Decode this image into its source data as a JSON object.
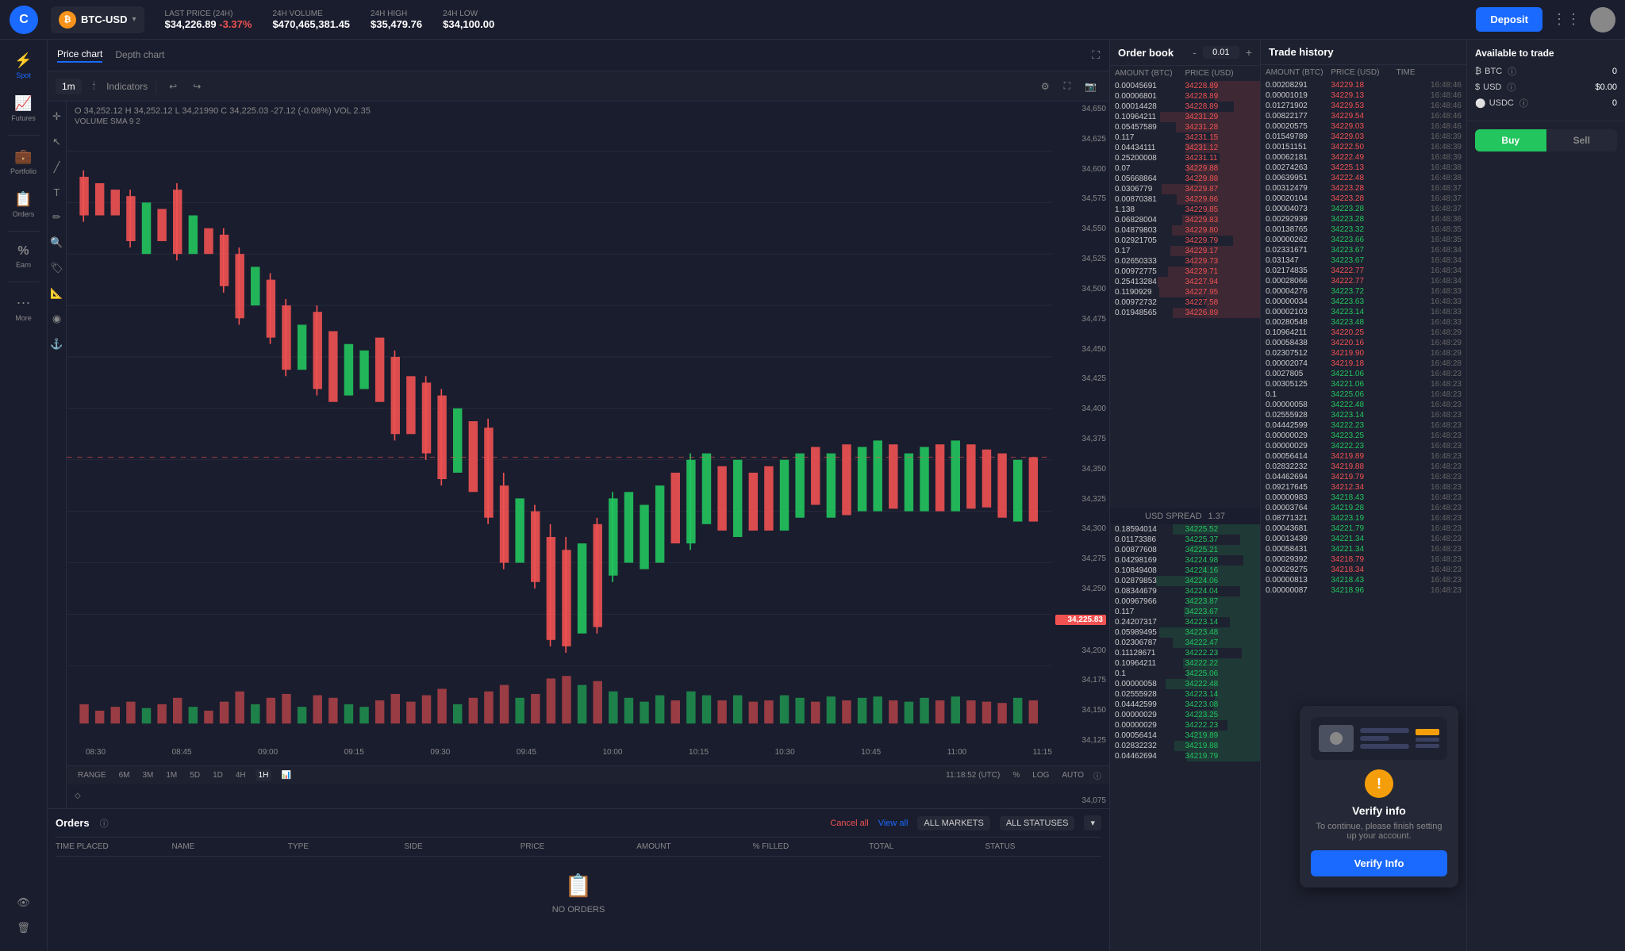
{
  "header": {
    "logo_text": "C",
    "pair": "BTC-USD",
    "btc_icon": "₿",
    "last_price_label": "LAST PRICE (24H)",
    "last_price": "$34,226.89",
    "last_price_change": "-3.37%",
    "volume_label": "24H VOLUME",
    "volume": "$470,465,381.45",
    "high_label": "24H HIGH",
    "high": "$35,479.76",
    "low_label": "24H LOW",
    "low": "$34,100.00",
    "deposit_label": "Deposit"
  },
  "sidebar": {
    "items": [
      {
        "id": "spot",
        "label": "Spot",
        "icon": "⚡",
        "active": true
      },
      {
        "id": "futures",
        "label": "Futures",
        "icon": "📈"
      },
      {
        "id": "portfolio",
        "label": "Portfolio",
        "icon": "💼"
      },
      {
        "id": "orders",
        "label": "Orders",
        "icon": "📋"
      },
      {
        "id": "earn",
        "label": "Earn",
        "icon": "%"
      },
      {
        "id": "more",
        "label": "More",
        "icon": "⋯"
      }
    ]
  },
  "chart": {
    "tabs": [
      "Price chart",
      "Depth chart"
    ],
    "active_tab": "Price chart",
    "timeframe": "1m",
    "ohlcv": "O 34,252.12  H 34,252.12  L 34,21990  C 34,225.03  -27.12 (-0.08%)  VOL 2.35",
    "volume_sma": "VOLUME SMA 9  2",
    "current_price": "34,225.83",
    "price_levels": [
      "34,650",
      "34,625",
      "34,600",
      "34,575",
      "34,550",
      "34,525",
      "34,500",
      "34,475",
      "34,450",
      "34,425",
      "34,400",
      "34,375",
      "34,350",
      "34,325",
      "34,300",
      "34,275",
      "34,250",
      "34,225",
      "34,200",
      "34,175",
      "34,150",
      "34,125",
      "34,100",
      "34,075"
    ],
    "time_labels": [
      "08:30",
      "08:45",
      "09:00",
      "09:15",
      "09:30",
      "09:45",
      "10:00",
      "10:15",
      "10:30",
      "10:45",
      "11:00",
      "11:15"
    ],
    "range_buttons": [
      "RANGE",
      "6M",
      "3M",
      "1M",
      "5D",
      "1D",
      "4H",
      "1H"
    ],
    "active_range": "1H",
    "bottom_info": "11:18:52 (UTC)  %  LOG  AUTO"
  },
  "orders_panel": {
    "title": "Orders",
    "cancel_all": "Cancel all",
    "view_all": "View all",
    "markets_filter": "ALL MARKETS",
    "statuses_filter": "ALL STATUSES",
    "columns": [
      "TIME PLACED",
      "NAME",
      "TYPE",
      "SIDE",
      "PRICE",
      "AMOUNT",
      "% FILLED",
      "TOTAL",
      "STATUS"
    ],
    "no_orders_text": "NO ORDERS"
  },
  "order_book": {
    "title": "Order book",
    "spread_value": "0.01",
    "usd_spread_label": "USD SPREAD",
    "usd_spread_value": "1.37",
    "columns": [
      "AMOUNT (BTC)",
      "PRICE (USD)"
    ],
    "asks": [
      {
        "amount": "0.00045691",
        "price": "34228.89"
      },
      {
        "amount": "0.00006801",
        "price": "34228.89"
      },
      {
        "amount": "0.00014428",
        "price": "34228.89"
      },
      {
        "amount": "0.10964211",
        "price": "34231.29"
      },
      {
        "amount": "0.05457589",
        "price": "34231.28"
      },
      {
        "amount": "0.117",
        "price": "34231.15"
      },
      {
        "amount": "0.04434111",
        "price": "34231.12"
      },
      {
        "amount": "0.25200008",
        "price": "34231.11"
      },
      {
        "amount": "0.07",
        "price": "34229.88"
      },
      {
        "amount": "0.05668864",
        "price": "34229.88"
      },
      {
        "amount": "0.0306779",
        "price": "34229.87"
      },
      {
        "amount": "0.00870381",
        "price": "34229.86"
      },
      {
        "amount": "1.138",
        "price": "34229.85"
      },
      {
        "amount": "0.06828004",
        "price": "34229.83"
      },
      {
        "amount": "0.04879803",
        "price": "34229.80"
      },
      {
        "amount": "0.02921705",
        "price": "34229.79"
      },
      {
        "amount": "0.17",
        "price": "34229.17"
      },
      {
        "amount": "0.02650333",
        "price": "34229.73"
      },
      {
        "amount": "0.00972775",
        "price": "34229.71"
      },
      {
        "amount": "0.25413284",
        "price": "34227.94"
      },
      {
        "amount": "0.1190929",
        "price": "34227.95"
      },
      {
        "amount": "0.00972732",
        "price": "34227.58"
      },
      {
        "amount": "0.01948565",
        "price": "34226.89"
      }
    ],
    "bids": [
      {
        "amount": "0.18594014",
        "price": "34225.52"
      },
      {
        "amount": "0.01173386",
        "price": "34225.37"
      },
      {
        "amount": "0.00877608",
        "price": "34225.21"
      },
      {
        "amount": "0.04298169",
        "price": "34224.98"
      },
      {
        "amount": "0.10849408",
        "price": "34224.16"
      },
      {
        "amount": "0.02879853",
        "price": "34224.06"
      },
      {
        "amount": "0.08344679",
        "price": "34224.04"
      },
      {
        "amount": "0.00967966",
        "price": "34223.87"
      },
      {
        "amount": "0.117",
        "price": "34223.67"
      },
      {
        "amount": "0.24207317",
        "price": "34223.14"
      },
      {
        "amount": "0.05989495",
        "price": "34223.48"
      },
      {
        "amount": "0.02306787",
        "price": "34222.47"
      },
      {
        "amount": "0.11128671",
        "price": "34222.23"
      },
      {
        "amount": "0.10964211",
        "price": "34222.22"
      },
      {
        "amount": "0.1",
        "price": "34225.06"
      },
      {
        "amount": "0.00000058",
        "price": "34222.48"
      },
      {
        "amount": "0.02555928",
        "price": "34223.14"
      },
      {
        "amount": "0.04442599",
        "price": "34223.08"
      },
      {
        "amount": "0.00000029",
        "price": "34223.25"
      },
      {
        "amount": "0.00000029",
        "price": "34222.23"
      },
      {
        "amount": "0.00056414",
        "price": "34219.89"
      },
      {
        "amount": "0.02832232",
        "price": "34219.88"
      },
      {
        "amount": "0.04462694",
        "price": "34219.79"
      }
    ]
  },
  "trade_history": {
    "title": "Trade history",
    "columns": [
      "AMOUNT (BTC)",
      "PRICE (USD)",
      "TIME"
    ],
    "rows": [
      {
        "amount": "0.00208291",
        "price": "34229.18",
        "time": "16:48:46",
        "side": "sell"
      },
      {
        "amount": "0.00001019",
        "price": "34229.13",
        "time": "16:48:46",
        "side": "sell"
      },
      {
        "amount": "0.01271902",
        "price": "34229.53",
        "time": "16:48:46",
        "side": "sell"
      },
      {
        "amount": "0.00822177",
        "price": "34229.54",
        "time": "16:48:46",
        "side": "sell"
      },
      {
        "amount": "0.00020575",
        "price": "34229.03",
        "time": "16:48:46",
        "side": "sell"
      },
      {
        "amount": "0.01549789",
        "price": "34229.03",
        "time": "16:48:39",
        "side": "sell"
      },
      {
        "amount": "0.00151151",
        "price": "34222.50",
        "time": "16:48:39",
        "side": "sell"
      },
      {
        "amount": "0.00062181",
        "price": "34222.49",
        "time": "16:48:39",
        "side": "sell"
      },
      {
        "amount": "0.00274263",
        "price": "34225.13",
        "time": "16:48:38",
        "side": "sell"
      },
      {
        "amount": "0.00639951",
        "price": "34222.48",
        "time": "16:48:38",
        "side": "sell"
      },
      {
        "amount": "0.00312479",
        "price": "34223.28",
        "time": "16:48:37",
        "side": "sell"
      },
      {
        "amount": "0.00020104",
        "price": "34223.28",
        "time": "16:48:37",
        "side": "sell"
      },
      {
        "amount": "0.00004073",
        "price": "34223.28",
        "time": "16:48:37",
        "side": "buy"
      },
      {
        "amount": "0.00292939",
        "price": "34223.28",
        "time": "16:48:36",
        "side": "buy"
      },
      {
        "amount": "0.00138765",
        "price": "34223.32",
        "time": "16:48:35",
        "side": "buy"
      },
      {
        "amount": "0.00000262",
        "price": "34223.66",
        "time": "16:48:35",
        "side": "buy"
      },
      {
        "amount": "0.02331671",
        "price": "34223.67",
        "time": "16:48:34",
        "side": "buy"
      },
      {
        "amount": "0.031347",
        "price": "34223.67",
        "time": "16:48:34",
        "side": "buy"
      },
      {
        "amount": "0.02174835",
        "price": "34222.77",
        "time": "16:48:34",
        "side": "sell"
      },
      {
        "amount": "0.00028066",
        "price": "34222.77",
        "time": "16:48:34",
        "side": "sell"
      },
      {
        "amount": "0.00004276",
        "price": "34223.72",
        "time": "16:48:33",
        "side": "buy"
      },
      {
        "amount": "0.00000034",
        "price": "34223.63",
        "time": "16:48:33",
        "side": "buy"
      },
      {
        "amount": "0.00002103",
        "price": "34223.14",
        "time": "16:48:33",
        "side": "buy"
      },
      {
        "amount": "0.00280548",
        "price": "34223.48",
        "time": "16:48:33",
        "side": "buy"
      },
      {
        "amount": "0.10964211",
        "price": "34220.25",
        "time": "16:48:29",
        "side": "sell"
      },
      {
        "amount": "0.00058438",
        "price": "34220.16",
        "time": "16:48:29",
        "side": "sell"
      },
      {
        "amount": "0.02307512",
        "price": "34219.90",
        "time": "16:48:29",
        "side": "sell"
      },
      {
        "amount": "0.00002074",
        "price": "34219.18",
        "time": "16:48:28",
        "side": "sell"
      },
      {
        "amount": "0.0027805",
        "price": "34221.06",
        "time": "16:48:23",
        "side": "buy"
      },
      {
        "amount": "0.00305125",
        "price": "34221.06",
        "time": "16:48:23",
        "side": "buy"
      },
      {
        "amount": "0.1",
        "price": "34225.06",
        "time": "16:48:23",
        "side": "buy"
      },
      {
        "amount": "0.00000058",
        "price": "34222.48",
        "time": "16:48:23",
        "side": "buy"
      },
      {
        "amount": "0.02555928",
        "price": "34223.14",
        "time": "16:48:23",
        "side": "buy"
      },
      {
        "amount": "0.04442599",
        "price": "34222.23",
        "time": "16:48:23",
        "side": "buy"
      },
      {
        "amount": "0.00000029",
        "price": "34223.25",
        "time": "16:48:23",
        "side": "buy"
      },
      {
        "amount": "0.00000029",
        "price": "34222.23",
        "time": "16:48:23",
        "side": "buy"
      },
      {
        "amount": "0.00056414",
        "price": "34219.89",
        "time": "16:48:23",
        "side": "sell"
      },
      {
        "amount": "0.02832232",
        "price": "34219.88",
        "time": "16:48:23",
        "side": "sell"
      },
      {
        "amount": "0.04462694",
        "price": "34219.79",
        "time": "16:48:23",
        "side": "sell"
      },
      {
        "amount": "0.09217645",
        "price": "34212.34",
        "time": "16:48:23",
        "side": "sell"
      },
      {
        "amount": "0.00000983",
        "price": "34218.43",
        "time": "16:48:23",
        "side": "buy"
      },
      {
        "amount": "0.00003764",
        "price": "34219.28",
        "time": "16:48:23",
        "side": "buy"
      },
      {
        "amount": "0.08771321",
        "price": "34223.19",
        "time": "16:48:23",
        "side": "buy"
      },
      {
        "amount": "0.00043681",
        "price": "34221.79",
        "time": "16:48:23",
        "side": "buy"
      },
      {
        "amount": "0.00013439",
        "price": "34221.34",
        "time": "16:48:23",
        "side": "buy"
      },
      {
        "amount": "0.00058431",
        "price": "34221.34",
        "time": "16:48:23",
        "side": "buy"
      },
      {
        "amount": "0.00029392",
        "price": "34218.79",
        "time": "16:48:23",
        "side": "sell"
      },
      {
        "amount": "0.00029275",
        "price": "34218.34",
        "time": "16:48:23",
        "side": "sell"
      },
      {
        "amount": "0.00000813",
        "price": "34218.43",
        "time": "16:48:23",
        "side": "buy"
      },
      {
        "amount": "0.00000087",
        "price": "34218.96",
        "time": "16:48:23",
        "side": "buy"
      }
    ]
  },
  "available_to_trade": {
    "title": "Available to trade",
    "currencies": [
      {
        "name": "BTC",
        "amount": "0",
        "icon": "₿"
      },
      {
        "name": "USD",
        "amount": "$0.00",
        "icon": "$"
      },
      {
        "name": "USDC",
        "amount": "0",
        "icon": "⚪"
      }
    ],
    "buy_label": "Buy",
    "sell_label": "Sell"
  },
  "verify_popup": {
    "title": "Verify info",
    "description": "To continue, please finish setting up your account.",
    "button_label": "Verify Info"
  }
}
